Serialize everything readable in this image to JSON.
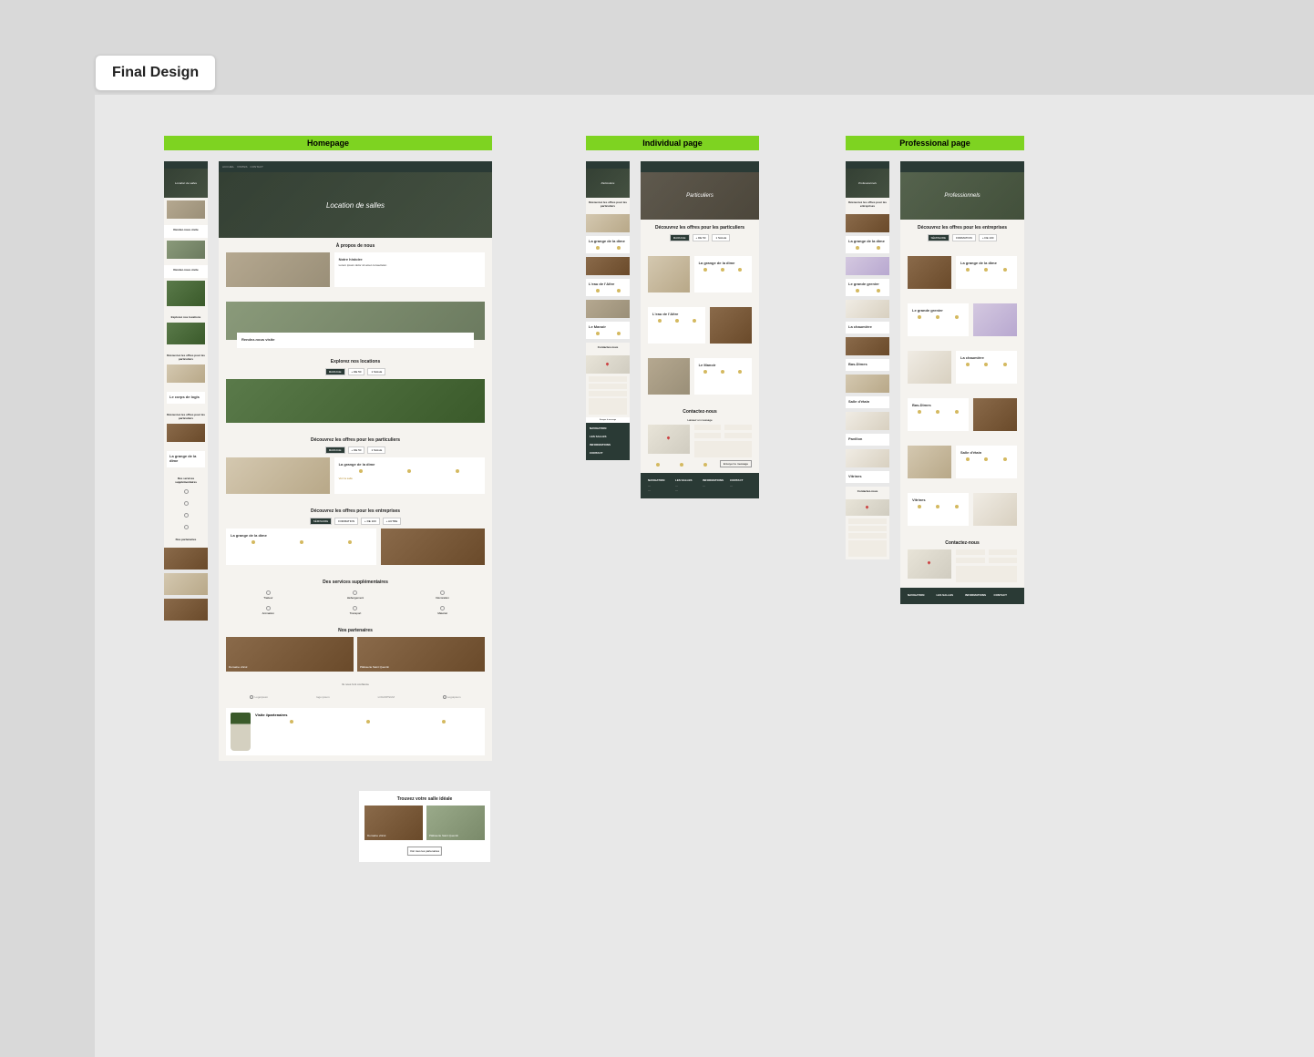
{
  "tag": "Final Design",
  "pages": {
    "homepage": {
      "label": "Homepage"
    },
    "individual": {
      "label": "Individual page"
    },
    "professional": {
      "label": "Professional  page"
    }
  },
  "nav": [
    "ACCUEIL",
    "VISITES",
    "CONTACT"
  ],
  "hero": {
    "homepage": "Location de salles",
    "homepage_mobile": "Location de salles",
    "individual": "Particuliers",
    "professional": "Professionnels",
    "professional_mobile": "Professionnels"
  },
  "sections": {
    "about": "À propos de nous",
    "venue_title": "Rendez-nous visite",
    "explore": "Explorez nos locations",
    "offers_particuliers": "Découvrez les offres pour les particuliers",
    "offers_entreprises": "Découvrez les offres pour les entreprises",
    "services": "Des services supplémentaires",
    "partners": "Nos partenaires",
    "find_venue": "Trouvez votre salle idéale",
    "contact": "Contactez-nous",
    "contact_sub": "Laissez un message",
    "trust": "Ils nous font confiance"
  },
  "cards": {
    "grange": "La grange de la dîme",
    "logis": "Le corps de logis",
    "eau": "L'eau de l'Aître",
    "manoir": "Le Manoir",
    "grenier": "Le grande grenier",
    "champs": "La chaumière",
    "bas": "Bas-Dîmes",
    "salle_etain": "Salle d'étain",
    "pavillon": "Pavillon",
    "vitrine": "Vitrines",
    "notre_histoire": "Notre histoire",
    "visite_title": "Visite #partenaires",
    "see_venue": "Voir la salle"
  },
  "tabs": {
    "t1": "MARIAGE",
    "t2": "+ DE 50",
    "t3": "1 SALLE",
    "t4": "SÉMINAIRE",
    "t5": "FORMATION",
    "t6": "+ DE 100",
    "t7": "+ AUTRE"
  },
  "partners": {
    "p1": "Domaine viticol",
    "p2": "Pâtisserie Saint Quentin",
    "see_all": "Voir tous les partenaires"
  },
  "logos": {
    "l1": "Logoipsum",
    "l2": "logo ipsum",
    "l3": "LOGOIPSUM",
    "l4": "Logoipsum"
  },
  "footer": {
    "c1": "NAVIGATION",
    "c2": "LES SALLES",
    "c3": "INFORMATIONS",
    "c4": "CONTACT",
    "send": "Envoyer le message"
  },
  "services": {
    "s1": "Traiteur",
    "s2": "Hébergement",
    "s3": "Décoration",
    "s4": "Animation",
    "s5": "Transport",
    "s6": "Matériel"
  }
}
